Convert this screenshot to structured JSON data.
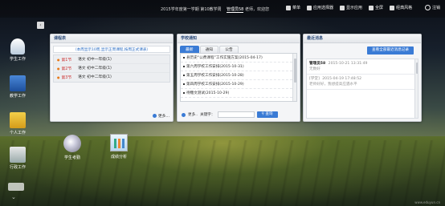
{
  "topbar": {
    "info": "2015学年度第一学期 第10教学周",
    "user_name": "管理员58",
    "user_suffix": "老师，欢迎您",
    "links": [
      {
        "icon": "grid-icon",
        "label": "菜单"
      },
      {
        "icon": "app-icon",
        "label": "应用选择器"
      },
      {
        "icon": "desktop-icon",
        "label": "显示应用"
      },
      {
        "icon": "fullscreen-icon",
        "label": "全屏"
      },
      {
        "icon": "style-icon",
        "label": "经典风格"
      }
    ],
    "logout": "注销"
  },
  "dock": [
    {
      "icon": "student-icon",
      "label": "学生工作"
    },
    {
      "icon": "teaching-icon",
      "label": "教学工作"
    },
    {
      "icon": "personal-icon",
      "label": "个人工作"
    },
    {
      "icon": "admin-icon",
      "label": "行政工作"
    }
  ],
  "shortcuts": [
    {
      "icon": "cd-icon",
      "label": "学生考勤"
    },
    {
      "icon": "chart-icon",
      "label": "成绩分析"
    }
  ],
  "schedule_panel": {
    "title": "课程表",
    "notice": "（本周显示10周,显示正周课程,按周正式课表）",
    "rows": [
      {
        "period": "第1节",
        "cls": "语文 初中一年级(1)"
      },
      {
        "period": "第2节",
        "cls": "语文 初中二年级(1)"
      },
      {
        "period": "第3节",
        "cls": "语文 初中二年级(1)"
      }
    ],
    "more": "更多..."
  },
  "notice_panel": {
    "title": "学校通知",
    "tabs": [
      "最新",
      "通知",
      "公告"
    ],
    "items": [
      "县历史“公费课程”工作实施方案(2015-04-17)",
      "第六周学校工作安排(2015-10-31)",
      "第五周学校工作安排(2015-10-28)",
      "第四周学校工作安排(2015-10-29)",
      "待糖文测试(2015-10-29)"
    ],
    "more": "更多..",
    "keyword_label": "关键字：",
    "query": "查询"
  },
  "message_panel": {
    "title": "最近消息",
    "view_all": "查看全部最近消息记录",
    "messages": [
      {
        "sender": "管理员58",
        "time": "2015-10-21 13:31:49",
        "body": "无数好"
      },
      {
        "sender": "[学堂]",
        "time": "2015-04-19 17:48:52",
        "body": "老师好好，我想提高应遇水平"
      }
    ]
  },
  "watermark": "www.eduyun.cn"
}
